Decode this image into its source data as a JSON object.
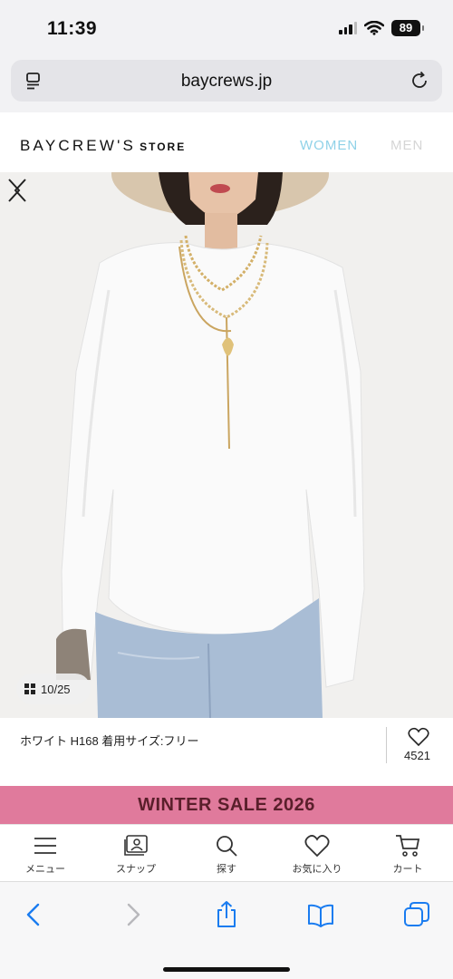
{
  "status": {
    "time": "11:39",
    "battery": "89"
  },
  "browser": {
    "url": "baycrews.jp"
  },
  "site": {
    "logo": "BAYCREW'S",
    "logo_store": "STORE",
    "nav": {
      "women": "WOMEN",
      "men": "MEN"
    }
  },
  "gallery": {
    "counter": "10/25"
  },
  "product": {
    "caption": "ホワイト H168 着用サイズ:フリー",
    "favorites_count": "4521"
  },
  "banner": {
    "text": "WINTER SALE 2026"
  },
  "bottom_nav": {
    "menu": "メニュー",
    "snap": "スナップ",
    "search": "探す",
    "favorites": "お気に入り",
    "cart": "カート"
  },
  "colors": {
    "accent": "#8fd2e8",
    "sale_bg": "#e07a9c",
    "sale_text": "#5a1f2b",
    "ios_blue": "#1a7cf0"
  },
  "icons": [
    "reader-icon",
    "reload-icon",
    "chevron-left-icon",
    "chevron-right-icon",
    "grid-icon",
    "heart-icon",
    "menu-icon",
    "snap-icon",
    "search-icon",
    "cart-icon",
    "back-icon",
    "forward-icon",
    "share-icon",
    "bookmarks-icon",
    "tabs-icon"
  ]
}
